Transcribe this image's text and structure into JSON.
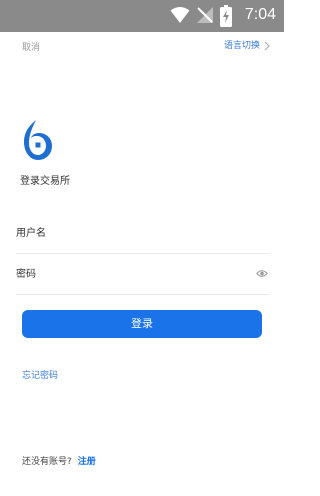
{
  "status_bar": {
    "time": "7:04",
    "icons": [
      "wifi-icon",
      "signal-off-icon",
      "battery-charging-icon"
    ]
  },
  "topbar": {
    "cancel_label": "取消",
    "language_label": "语言切换"
  },
  "brand": {
    "title": "登录交易所",
    "logo_icon": "flame-logo-icon"
  },
  "form": {
    "username_placeholder": "用户名",
    "password_placeholder": "密码",
    "login_label": "登录"
  },
  "links": {
    "forgot_password": "忘记密码",
    "register_prompt": "还没有账号?",
    "register_label": "注册"
  },
  "colors": {
    "accent": "#1a73e8",
    "link": "#3a7bd5",
    "status_bar": "#8a8a8a"
  }
}
